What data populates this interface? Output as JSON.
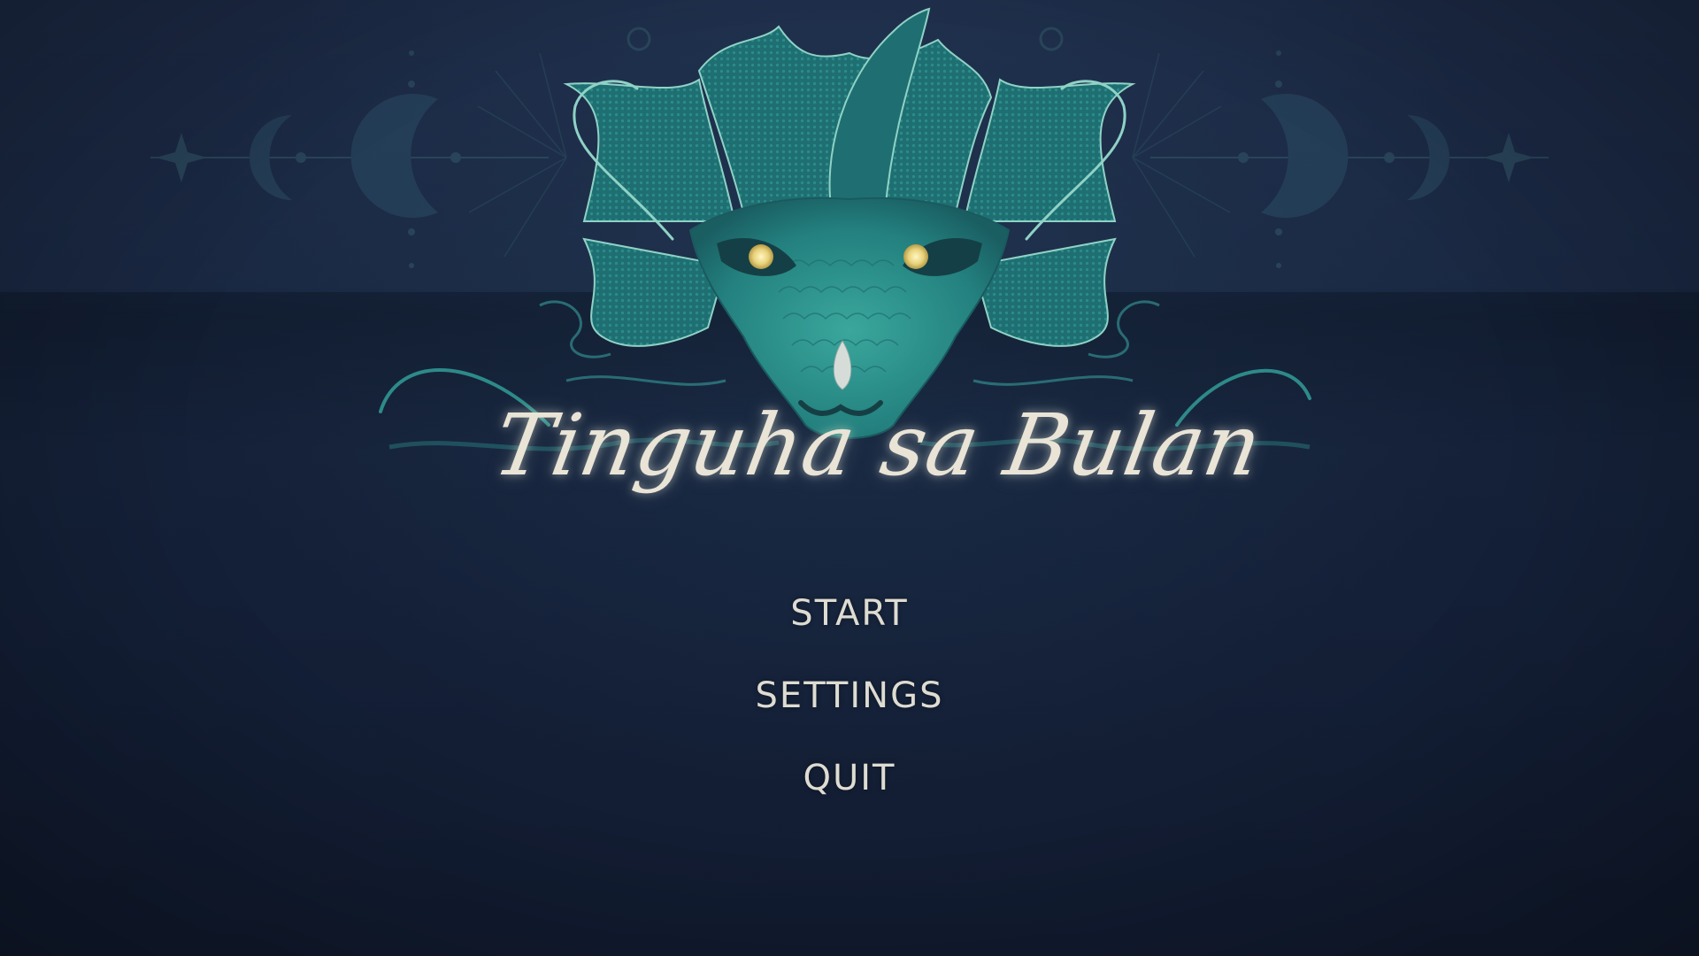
{
  "game": {
    "title": "Tinguha sa Bulan"
  },
  "menu": {
    "start_label": "START",
    "settings_label": "SETTINGS",
    "quit_label": "QUIT"
  },
  "colors": {
    "background": "#18233a",
    "dragon_teal": "#2a9a92",
    "dragon_dark": "#1c5f62",
    "outline": "#8fd2c6",
    "eye": "#f3e7a2",
    "title_text": "#e9e4d6",
    "menu_text": "#dedcd2",
    "ornament": "#2c4a5e"
  },
  "icons": [
    "dragon-emblem",
    "crescent-moon-icon",
    "sparkle-star-icon"
  ]
}
